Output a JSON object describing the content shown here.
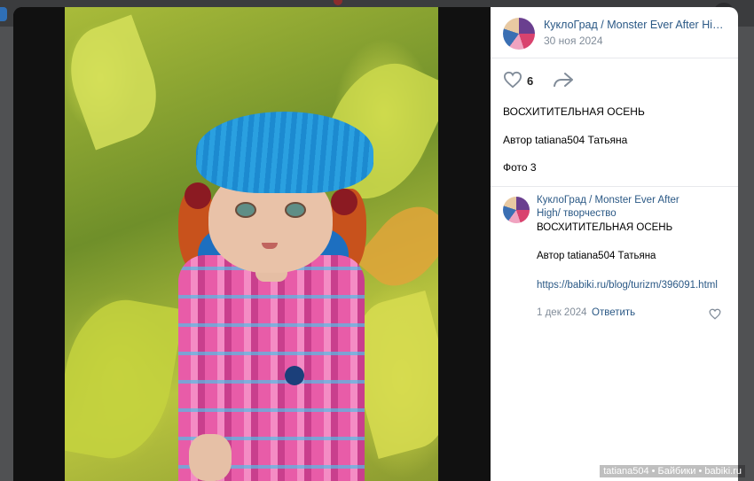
{
  "background": {
    "accent_color": "#2f6fb6"
  },
  "post": {
    "group_name": "КуклоГрад / Monster Ever After High/ творчество",
    "date": "30 ноя 2024",
    "likes": "6",
    "title": "ВОСХИТИТЕЛЬНАЯ ОСЕНЬ",
    "author_line": "Автор tatiana504 Татьяна",
    "photo_line": "Фото 3"
  },
  "comment": {
    "author": "КуклоГрад / Monster Ever After High/ творчество",
    "line1": "ВОСХИТИТЕЛЬНАЯ ОСЕНЬ",
    "line2": "Автор tatiana504 Татьяна",
    "link": "https://babiki.ru/blog/turizm/396091.html",
    "date": "1 дек 2024",
    "reply_label": "Ответить"
  },
  "watermark": "tatiana504 • Байбики • babiki.ru",
  "icons": {
    "like": "heart-icon",
    "share": "share-arrow-icon",
    "comment_like": "heart-icon"
  },
  "colors": {
    "link": "#2a5885",
    "muted": "#818c99"
  }
}
